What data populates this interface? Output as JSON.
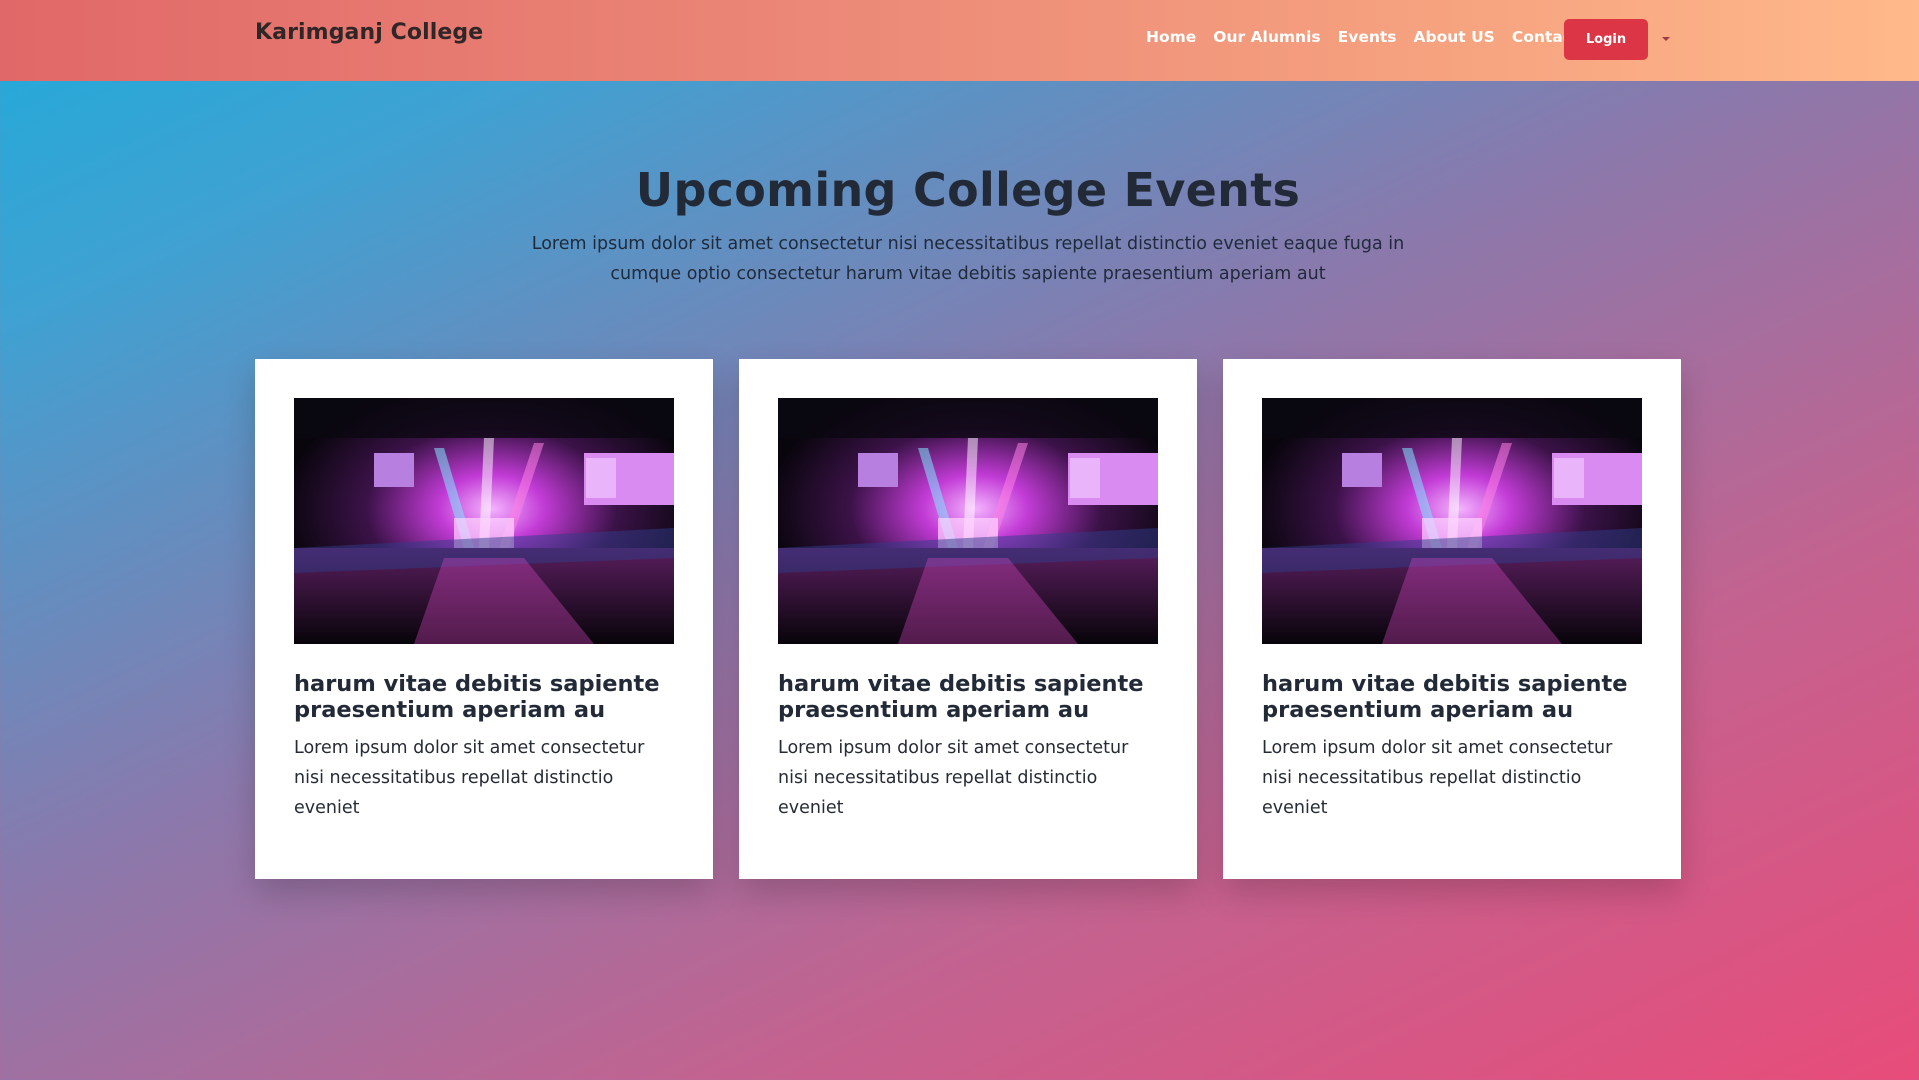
{
  "navbar": {
    "brand": "Karimganj College",
    "links": [
      "Home",
      "Our Alumnis",
      "Events",
      "About US",
      "Contact"
    ],
    "login_label": "Login"
  },
  "section": {
    "title": "Upcoming College Events",
    "description": "Lorem ipsum dolor sit amet consectetur nisi necessitatibus repellat distinctio eveniet eaque fuga in cumque optio consectetur harum vitae debitis sapiente praesentium aperiam aut"
  },
  "events": [
    {
      "image": "concert-stage-image",
      "title": "harum vitae debitis sapiente praesentium aperiam au",
      "text": "Lorem ipsum dolor sit amet consectetur nisi necessitatibus repellat distinctio eveniet"
    },
    {
      "image": "concert-stage-image",
      "title": "harum vitae debitis sapiente praesentium aperiam au",
      "text": "Lorem ipsum dolor sit amet consectetur nisi necessitatibus repellat distinctio eveniet"
    },
    {
      "image": "concert-stage-image",
      "title": "harum vitae debitis sapiente praesentium aperiam au",
      "text": "Lorem ipsum dolor sit amet consectetur nisi necessitatibus repellat distinctio eveniet"
    }
  ],
  "colors": {
    "navbar_start": "#e16868",
    "navbar_end": "#ffb98a",
    "login_button": "#dc3545",
    "background_start": "#20aad9",
    "background_end": "#e84c7a"
  }
}
